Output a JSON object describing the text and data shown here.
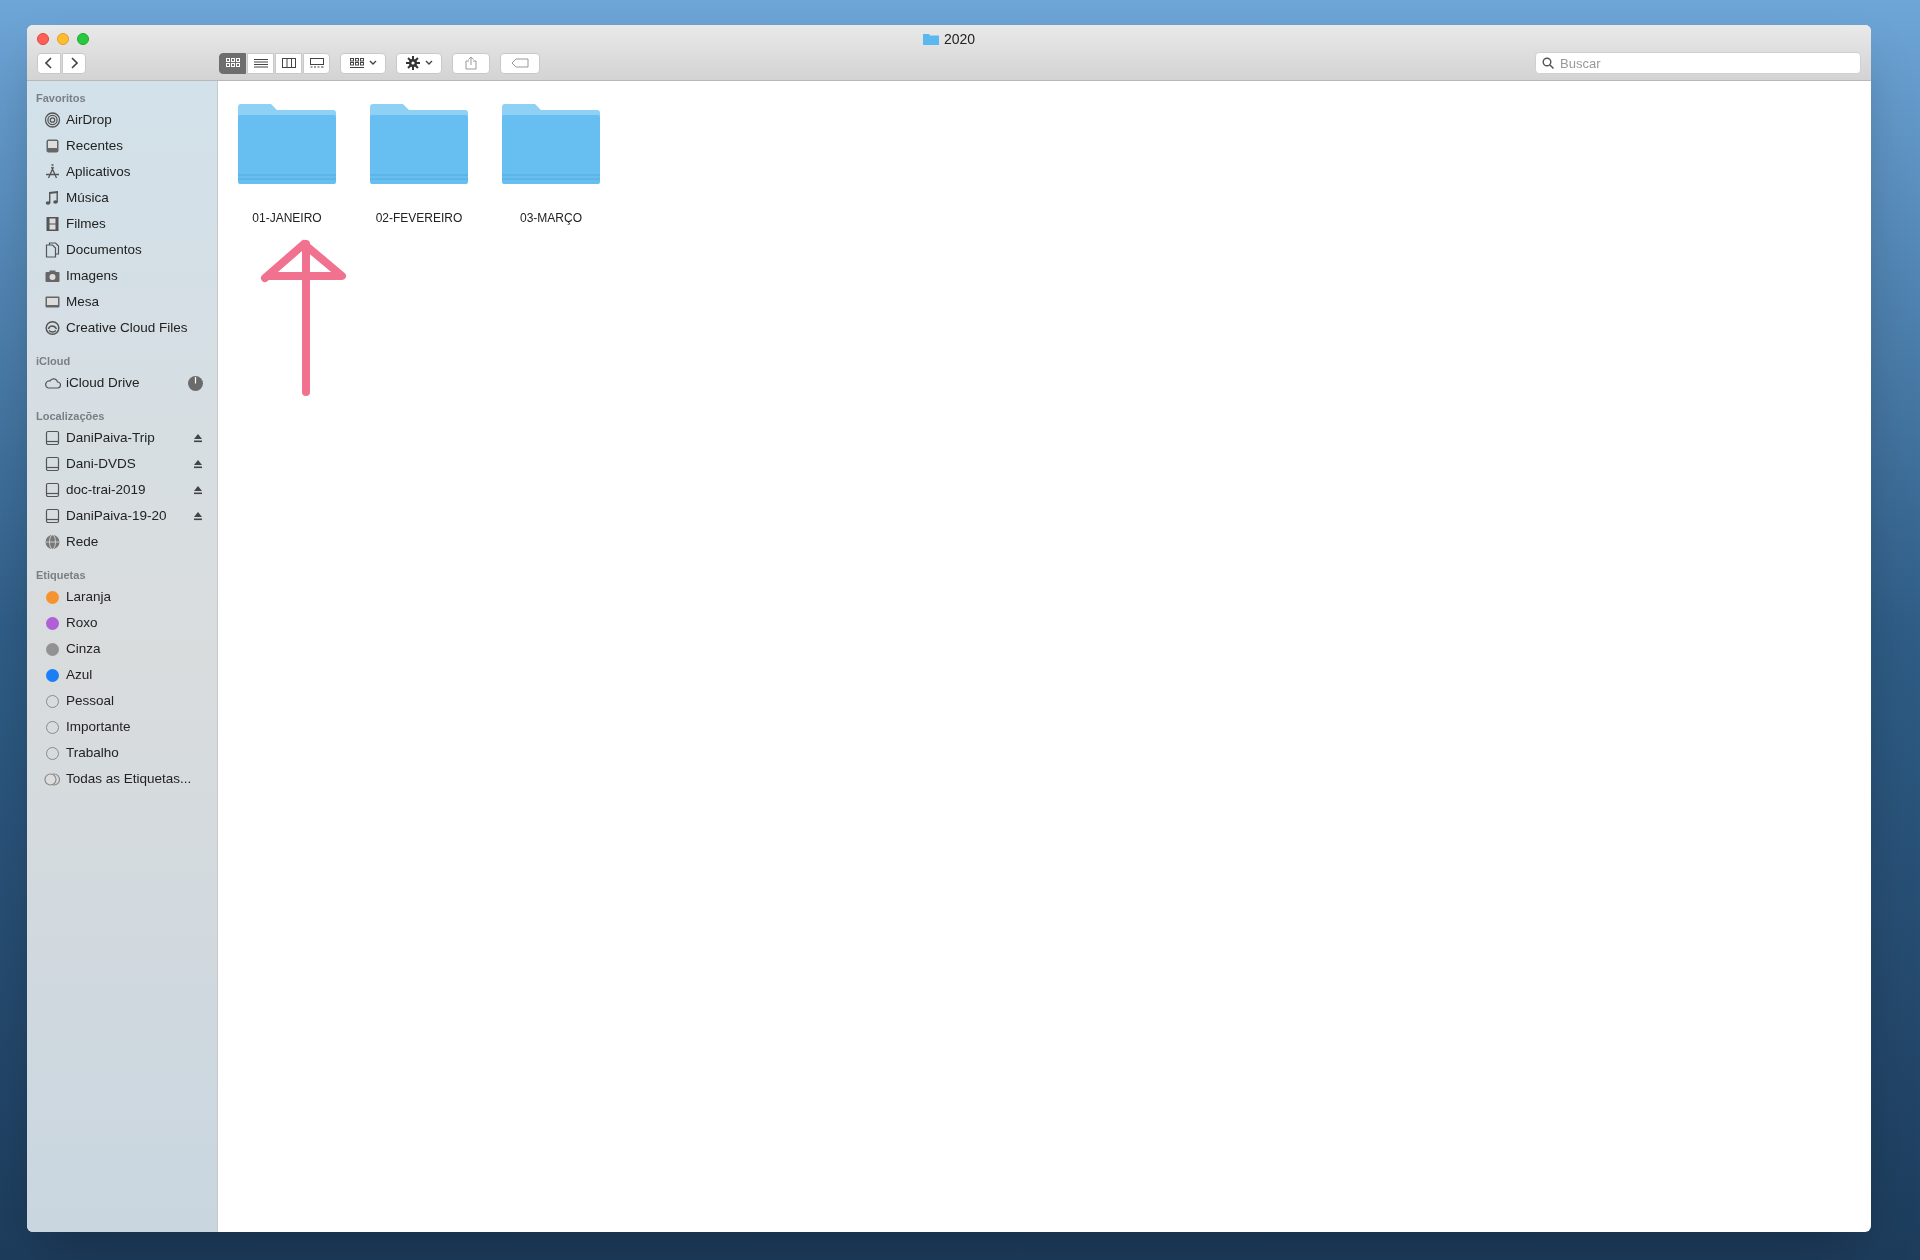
{
  "window": {
    "title": "2020"
  },
  "toolbar": {
    "views": [
      {
        "kind": "icons",
        "selected": true
      },
      {
        "kind": "list",
        "selected": false
      },
      {
        "kind": "columns",
        "selected": false
      },
      {
        "kind": "gallery",
        "selected": false
      }
    ],
    "search": {
      "placeholder": "Buscar"
    }
  },
  "sidebar": {
    "sections": [
      {
        "title": "Favoritos",
        "items": [
          {
            "kind": "airdrop",
            "label": "AirDrop"
          },
          {
            "kind": "recents",
            "label": "Recentes"
          },
          {
            "kind": "apps",
            "label": "Aplicativos"
          },
          {
            "kind": "music",
            "label": "Música"
          },
          {
            "kind": "movies",
            "label": "Filmes"
          },
          {
            "kind": "documents",
            "label": "Documentos"
          },
          {
            "kind": "pictures",
            "label": "Imagens"
          },
          {
            "kind": "desktop",
            "label": "Mesa"
          },
          {
            "kind": "cloud-files",
            "label": "Creative Cloud Files"
          }
        ]
      },
      {
        "title": "iCloud",
        "items": [
          {
            "kind": "icloud",
            "label": "iCloud Drive",
            "syncing": true
          }
        ]
      },
      {
        "title": "Localizações",
        "items": [
          {
            "kind": "disk",
            "label": "DaniPaiva-Trip",
            "ejectable": true
          },
          {
            "kind": "disk",
            "label": "Dani-DVDS",
            "ejectable": true
          },
          {
            "kind": "disk",
            "label": "doc-trai-2019",
            "ejectable": true
          },
          {
            "kind": "disk",
            "label": "DaniPaiva-19-20",
            "ejectable": true
          },
          {
            "kind": "network",
            "label": "Rede"
          }
        ]
      },
      {
        "title": "Etiquetas",
        "items": [
          {
            "kind": "tag",
            "label": "Laranja",
            "color": "#f7932f"
          },
          {
            "kind": "tag",
            "label": "Roxo",
            "color": "#b05fd6"
          },
          {
            "kind": "tag",
            "label": "Cinza",
            "color": "#929292"
          },
          {
            "kind": "tag",
            "label": "Azul",
            "color": "#1a7ef6"
          },
          {
            "kind": "tag-empty",
            "label": "Pessoal"
          },
          {
            "kind": "tag-empty",
            "label": "Importante"
          },
          {
            "kind": "tag-empty",
            "label": "Trabalho"
          },
          {
            "kind": "all-tags",
            "label": "Todas as Etiquetas..."
          }
        ]
      }
    ]
  },
  "folders": [
    {
      "name": "01-JANEIRO"
    },
    {
      "name": "02-FEVEREIRO"
    },
    {
      "name": "03-MARÇO"
    }
  ]
}
